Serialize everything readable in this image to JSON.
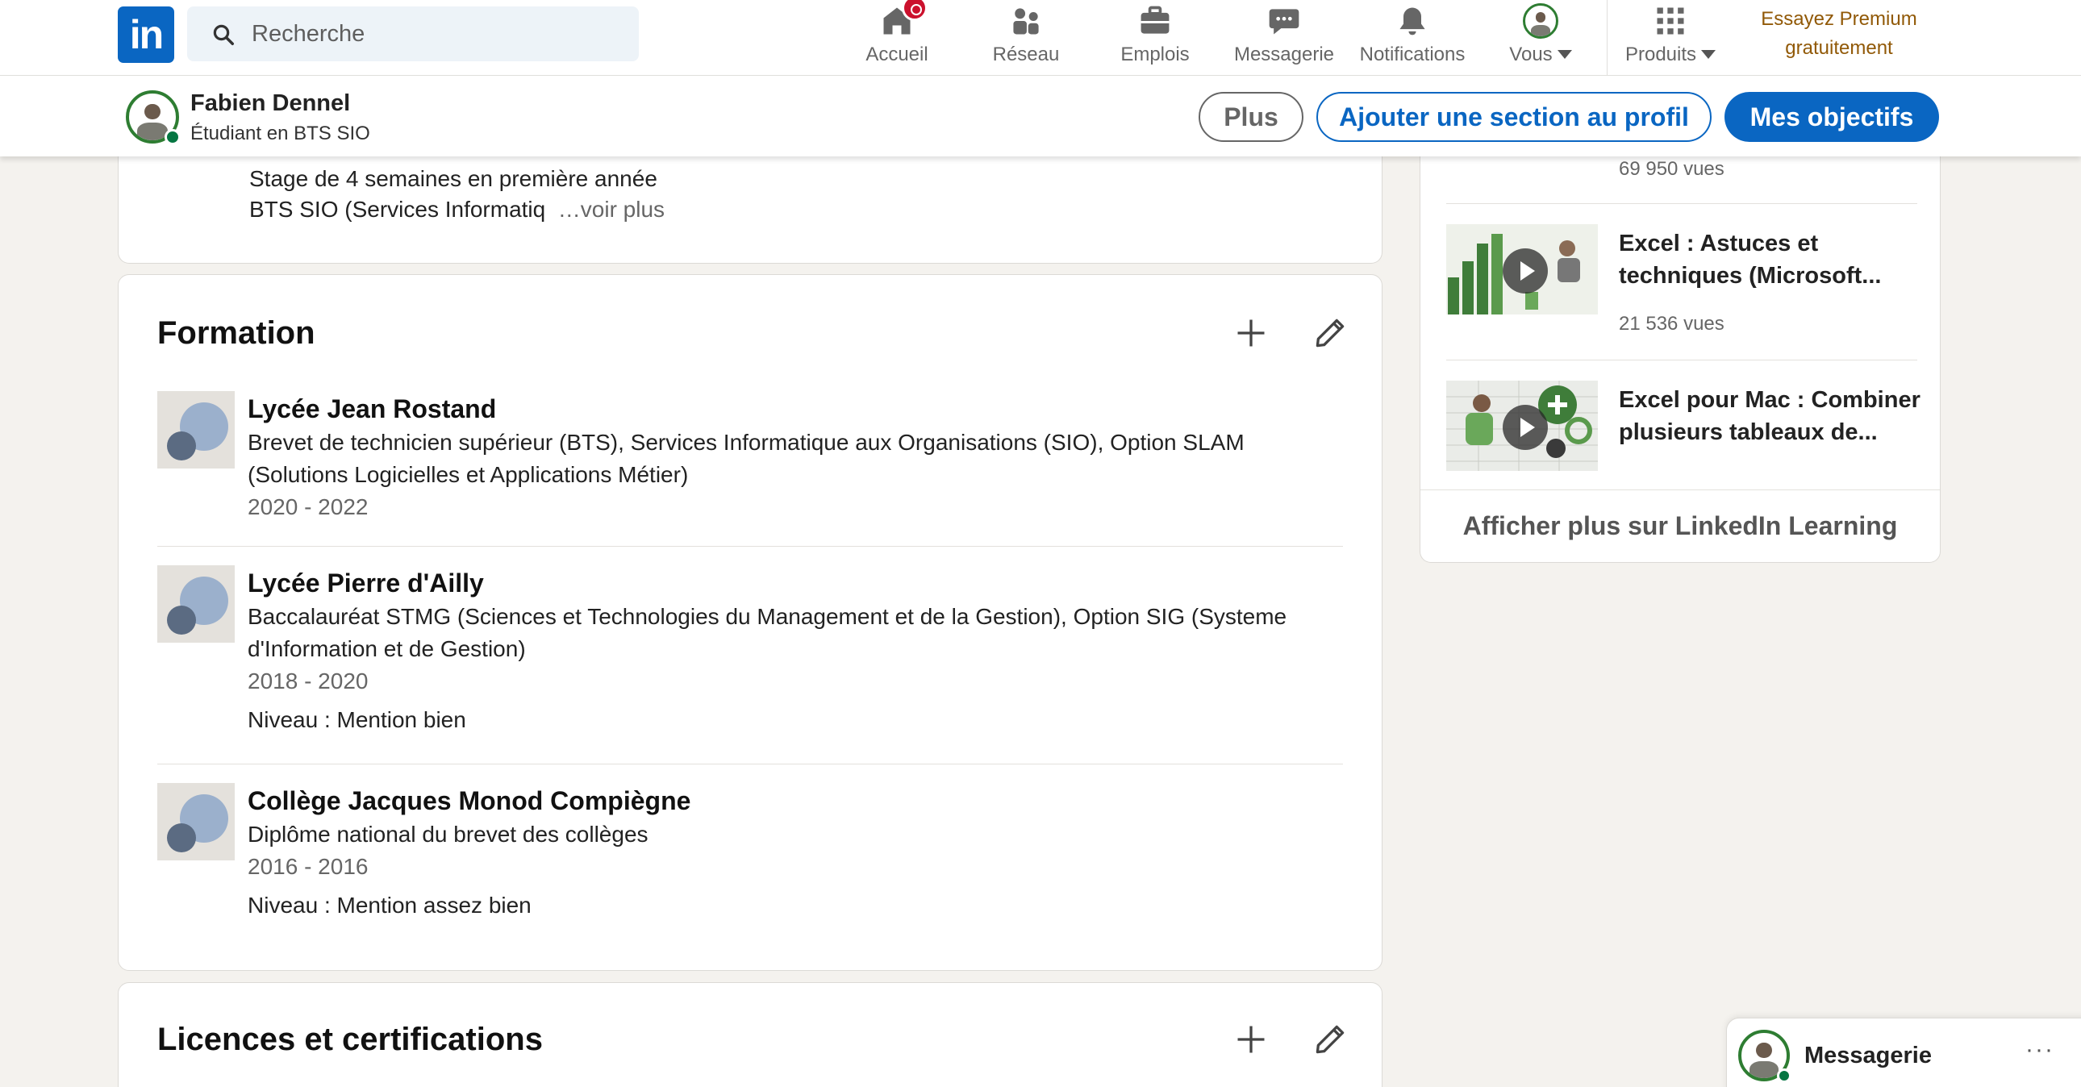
{
  "nav": {
    "logo_text": "in",
    "search_placeholder": "Recherche",
    "items": [
      {
        "label": "Accueil",
        "icon": "home-icon"
      },
      {
        "label": "Réseau",
        "icon": "network-icon"
      },
      {
        "label": "Emplois",
        "icon": "briefcase-icon"
      },
      {
        "label": "Messagerie",
        "icon": "chat-icon"
      },
      {
        "label": "Notifications",
        "icon": "bell-icon"
      },
      {
        "label": "Vous",
        "icon": "avatar"
      },
      {
        "label": "Produits",
        "icon": "grid-icon"
      }
    ],
    "premium_line1": "Essayez Premium",
    "premium_line2": "gratuitement"
  },
  "profile_bar": {
    "name": "Fabien Dennel",
    "headline": "Étudiant en BTS SIO",
    "btn_more": "Plus",
    "btn_add_section": "Ajouter une section au profil",
    "btn_goals": "Mes objectifs"
  },
  "experience_tail": {
    "line1": "Stage de 4 semaines en première année",
    "line2": "BTS SIO (Services Informatiq",
    "see_more": "…voir plus"
  },
  "formation": {
    "title": "Formation",
    "items": [
      {
        "school": "Lycée Jean Rostand",
        "degree": "Brevet de technicien supérieur (BTS), Services Informatique aux Organisations (SIO), Option SLAM (Solutions Logicielles et Applications Métier)",
        "dates": "2020 - 2022",
        "grade": ""
      },
      {
        "school": "Lycée Pierre d'Ailly",
        "degree": "Baccalauréat STMG (Sciences et Technologies du Management et de la Gestion), Option SIG (Systeme d'Information et de Gestion)",
        "dates": "2018 - 2020",
        "grade": "Niveau : Mention bien"
      },
      {
        "school": "Collège Jacques Monod Compiègne",
        "degree": "Diplôme national du brevet des collèges",
        "dates": "2016 - 2016",
        "grade": "Niveau : Mention assez bien"
      }
    ]
  },
  "licences": {
    "title": "Licences et certifications"
  },
  "learning": {
    "top_views": "69 950 vues",
    "courses": [
      {
        "title": "Excel : Astuces et techniques (Microsoft...",
        "views": "21 536 vues"
      },
      {
        "title": "Excel pour Mac : Combiner plusieurs tableaux de...",
        "views": ""
      }
    ],
    "footer": "Afficher plus sur LinkedIn Learning"
  },
  "messaging": {
    "title": "Messagerie",
    "more": "···"
  },
  "colors": {
    "brand": "#0a66c2",
    "premium": "#915907",
    "notification": "#cb112d",
    "online": "#057642"
  }
}
